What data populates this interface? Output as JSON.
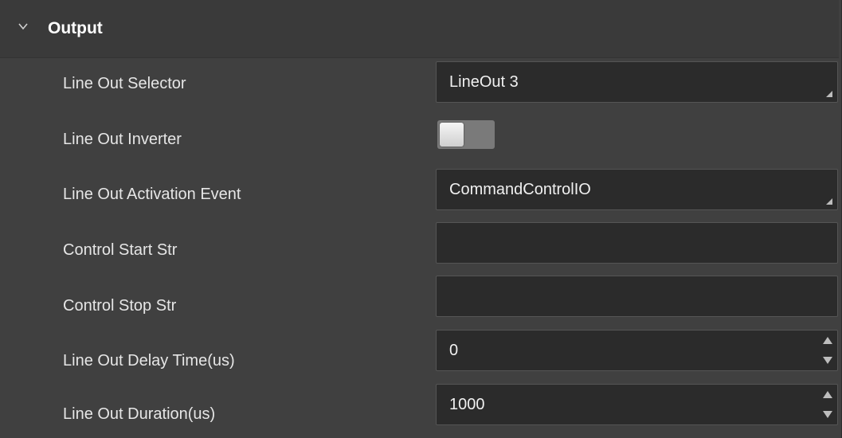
{
  "section": {
    "title": "Output",
    "icon": "chevron-down-icon"
  },
  "rows": [
    {
      "label": "Line Out Selector",
      "value": "LineOut 3",
      "type": "dropdown"
    },
    {
      "label": "Line Out Inverter",
      "value": "off",
      "type": "toggle"
    },
    {
      "label": "Line Out Activation Event",
      "value": "CommandControlIO",
      "type": "dropdown"
    },
    {
      "label": "Control Start Str",
      "value": "",
      "type": "text"
    },
    {
      "label": "Control Stop Str",
      "value": "",
      "type": "text"
    },
    {
      "label": "Line Out Delay Time(us)",
      "value": "0",
      "type": "spinbox"
    },
    {
      "label": "Line Out Duration(us)",
      "value": "1000",
      "type": "spinbox"
    }
  ],
  "colors": {
    "panel_bg": "#404040",
    "field_bg": "#2b2b2b",
    "text": "#e6e6e6"
  }
}
